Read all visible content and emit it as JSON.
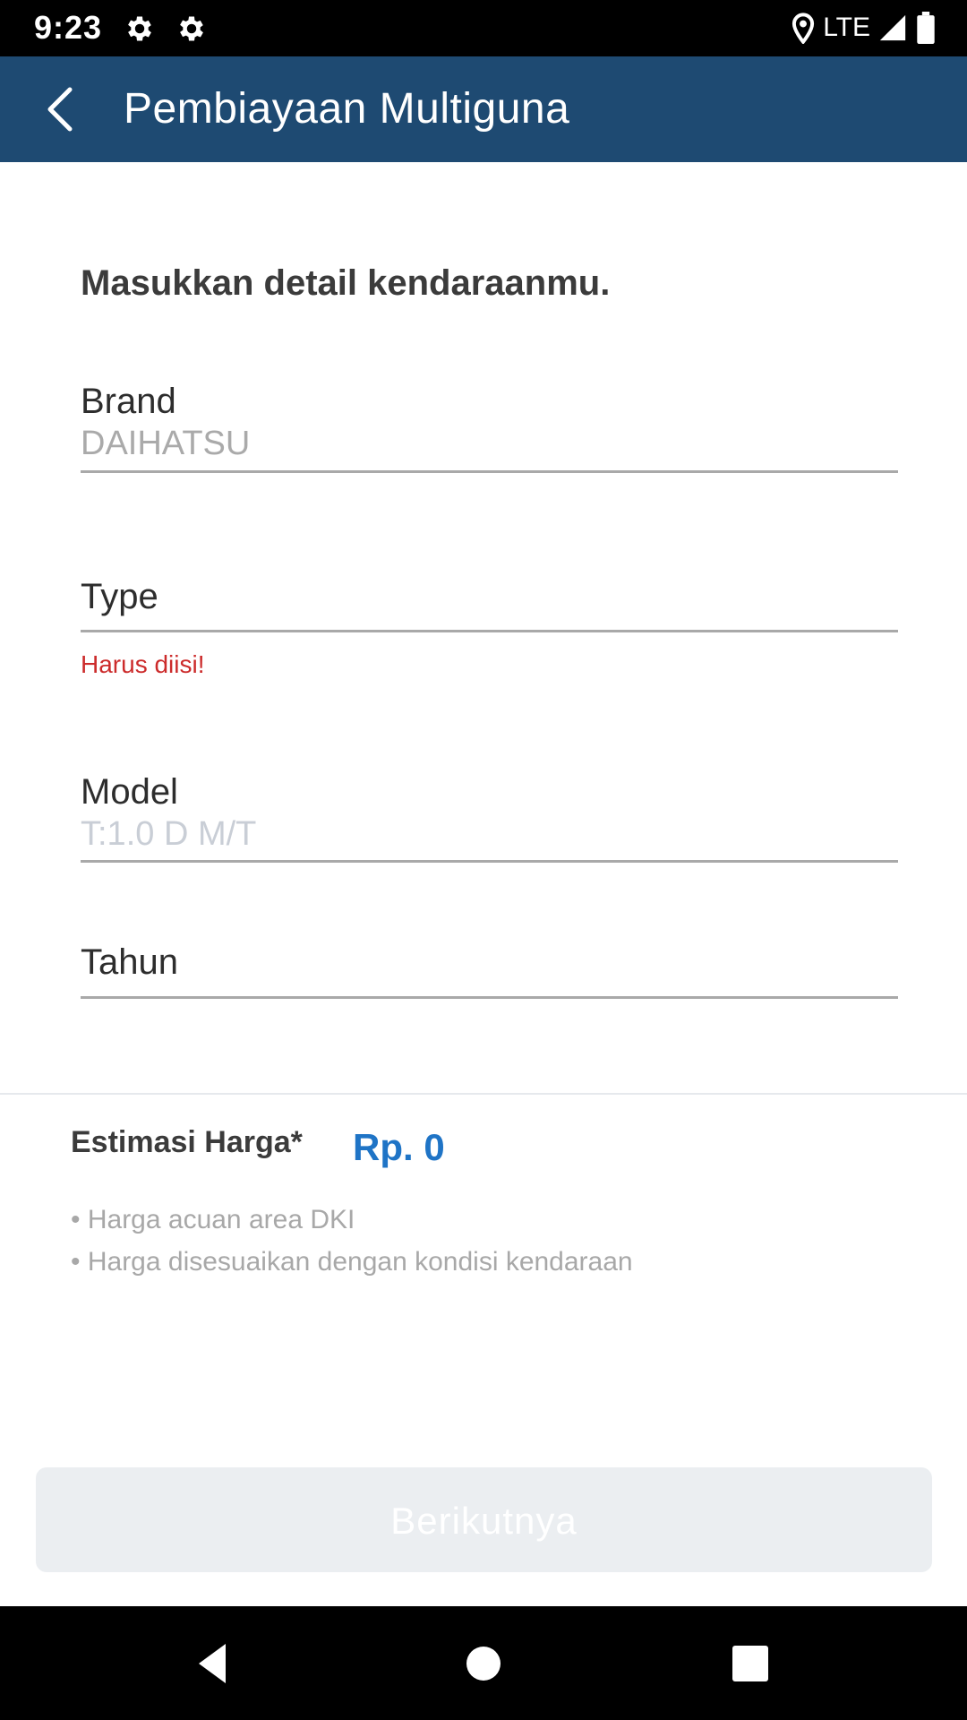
{
  "status_bar": {
    "time": "9:23",
    "network": "LTE",
    "icons": [
      "settings-icon",
      "settings-icon",
      "location-icon",
      "signal-icon",
      "battery-icon"
    ]
  },
  "app_bar": {
    "title": "Pembiayaan Multiguna",
    "back_icon": "chevron-left-icon",
    "background_color": "#1e4a72"
  },
  "form": {
    "heading": "Masukkan detail kendaraanmu.",
    "fields": [
      {
        "label": "Brand",
        "value": "DAIHATSU"
      },
      {
        "label": "Type",
        "value": "",
        "error": "Harus diisi!"
      },
      {
        "label": "Model",
        "value": "T:1.0 D M/T"
      },
      {
        "label": "Tahun",
        "value": ""
      }
    ]
  },
  "estimate": {
    "label": "Estimasi Harga*",
    "value": "Rp. 0",
    "value_color": "#1f74c6",
    "notes": [
      "• Harga acuan area DKI",
      "• Harga disesuaikan dengan kondisi kendaraan"
    ]
  },
  "next_button": {
    "label": "Berikutnya",
    "enabled": false
  },
  "nav_bar": {
    "icons": [
      "back-triangle-icon",
      "home-circle-icon",
      "recents-square-icon"
    ]
  }
}
